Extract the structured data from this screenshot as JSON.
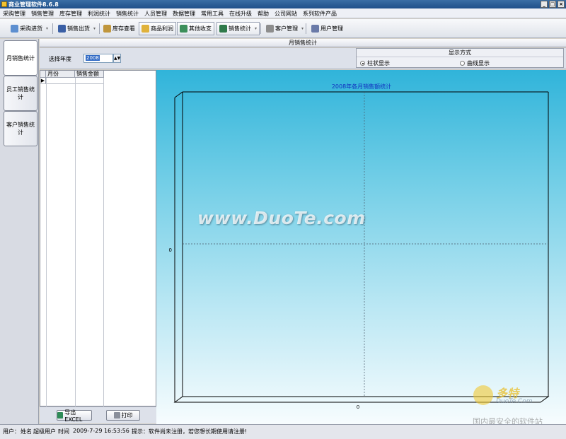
{
  "window": {
    "title": "商业管理软件8.6.8",
    "buttons": [
      "_",
      "□",
      "×"
    ]
  },
  "menu": [
    "采购管理",
    "销售管理",
    "库存管理",
    "利润统计",
    "销售统计",
    "人员管理",
    "数据管理",
    "常用工具",
    "在线升级",
    "帮助",
    "公司网站",
    "系列软件产品"
  ],
  "toolbar": [
    {
      "label": "采购进货",
      "icon": "purchase-icon",
      "has_caret": true
    },
    {
      "label": "销售出货",
      "icon": "sales-icon",
      "has_caret": true
    },
    {
      "label": "库存查看",
      "icon": "warehouse-icon",
      "has_caret": false
    },
    {
      "label": "商品利润",
      "icon": "profit-icon",
      "has_caret": false
    },
    {
      "label": "其他收支",
      "icon": "ledger-icon",
      "has_caret": false
    },
    {
      "label": "销售统计",
      "icon": "chart-icon",
      "has_caret": true
    },
    {
      "label": "客户管理",
      "icon": "customer-icon",
      "has_caret": true
    },
    {
      "label": "用户管理",
      "icon": "users-icon",
      "has_caret": false
    }
  ],
  "caret_glyph": "▾",
  "side_tabs": [
    "月销售统计",
    "员工销售统计",
    "客户销售统计"
  ],
  "section_title": "月销售统计",
  "year_selector": {
    "label": "选择年度",
    "value": "2008",
    "spin": "▲▼"
  },
  "display_mode": {
    "title": "显示方式",
    "options": [
      "柱状显示",
      "曲线显示"
    ],
    "selected": 0
  },
  "grid": {
    "columns": [
      "月份",
      "销售金额"
    ],
    "row_pointer": "▶"
  },
  "buttons": {
    "export": "导出EXCEL",
    "print": "打印"
  },
  "chart_data": {
    "type": "bar",
    "title": "2008年各月销售额统计",
    "categories": [],
    "values": [],
    "y_tick_labels": [
      "0"
    ],
    "x_tick_labels": [
      "0"
    ],
    "grid": true
  },
  "watermark": "www.DuoTe.com",
  "logo": {
    "text": "多特",
    "sub": "DuoTe.Com"
  },
  "slogan": "国内最安全的软件站",
  "status": {
    "user_label": "用户：",
    "name_label": "姓名",
    "name_value": "超级用户",
    "time_label": "时间",
    "time_value": "2009-7-29 16:53:56",
    "hint": "提示：软件尚未注册，若您想长期使用请注册!"
  },
  "colors": {
    "chart_top": "#30b4da",
    "chart_bottom": "#f7fcfe",
    "title_text": "#1030c0",
    "selection": "#316ac5"
  }
}
